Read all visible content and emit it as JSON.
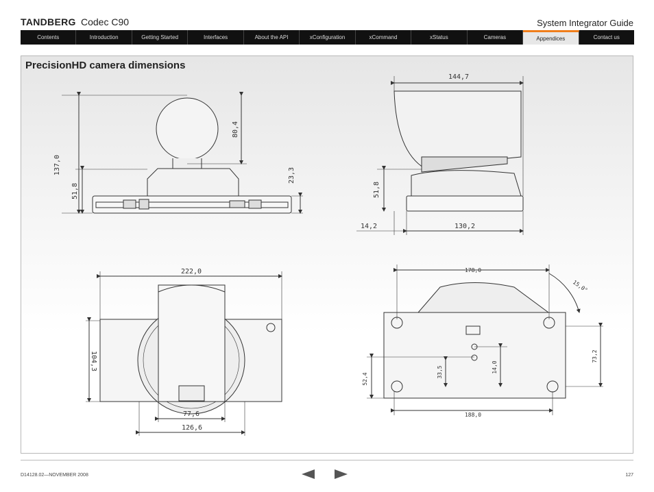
{
  "header": {
    "brand": "TANDBERG",
    "product": "Codec C90",
    "guide_title": "System Integrator Guide"
  },
  "nav": {
    "items": [
      {
        "label": "Contents"
      },
      {
        "label": "Introduction"
      },
      {
        "label": "Getting Started"
      },
      {
        "label": "Interfaces"
      },
      {
        "label": "About the API"
      },
      {
        "label": "xConfiguration"
      },
      {
        "label": "xCommand"
      },
      {
        "label": "xStatus"
      },
      {
        "label": "Cameras"
      },
      {
        "label": "Appendices"
      },
      {
        "label": "Contact us"
      }
    ],
    "active": "Appendices",
    "accent_color": "#f07d1a"
  },
  "page": {
    "title": "PrecisionHD camera dimensions"
  },
  "dimensions": {
    "front_height_total": "137,0",
    "front_head_height": "80,4",
    "front_base_height": "51,8",
    "front_foot_height": "23,3",
    "side_depth": "144,7",
    "side_base_height": "51,8",
    "side_offset": "14,2",
    "side_base_depth": "130,2",
    "top_width": "222,0",
    "top_depth": "104,3",
    "top_head_width": "77,6",
    "top_lens_width": "126,6",
    "bottom_width": "178,0",
    "bottom_angle": "15,0°",
    "bottom_hole_depth": "73,2",
    "bottom_depth": "52,4",
    "bottom_hole_a": "33,5",
    "bottom_hole_b": "14,0",
    "bottom_hole_spacing": "188,0"
  },
  "footer": {
    "doc_id": "D14128.02—NOVEMBER 2008",
    "page_number": "127",
    "arrow_color": "#555555"
  }
}
